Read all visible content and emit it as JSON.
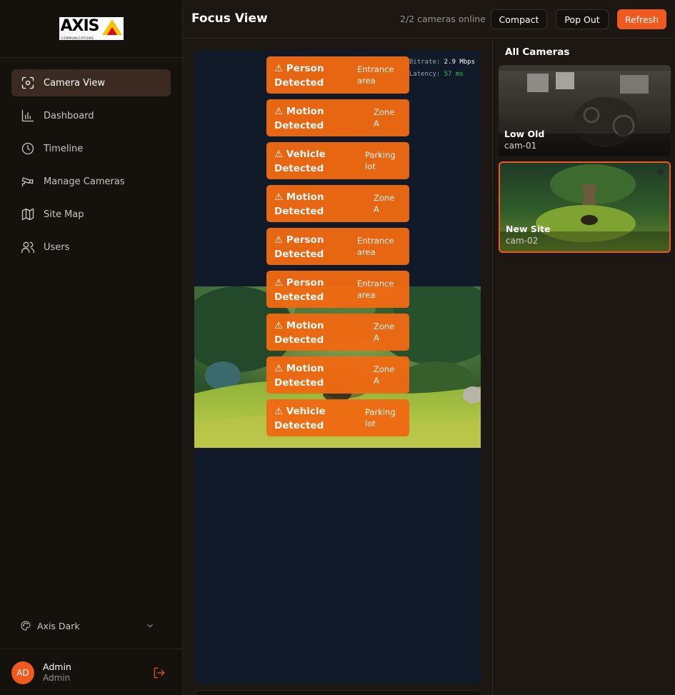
{
  "brand": {
    "logo_text": "AXIS",
    "logo_sub": "COMMUNICATIONS"
  },
  "sidebar": {
    "items": [
      {
        "label": "Camera View",
        "icon": "camera-focus-icon",
        "active": true
      },
      {
        "label": "Dashboard",
        "icon": "bar-chart-icon",
        "active": false
      },
      {
        "label": "Timeline",
        "icon": "clock-icon",
        "active": false
      },
      {
        "label": "Manage Cameras",
        "icon": "cctv-icon",
        "active": false
      },
      {
        "label": "Site Map",
        "icon": "map-icon",
        "active": false
      },
      {
        "label": "Users",
        "icon": "users-icon",
        "active": false
      }
    ],
    "theme": {
      "label": "Axis Dark",
      "icon": "palette-icon"
    },
    "user": {
      "initials": "AD",
      "name": "Admin",
      "role": "Admin"
    }
  },
  "header": {
    "title": "Focus View",
    "status": "2/2 cameras online",
    "buttons": {
      "compact": "Compact",
      "popout": "Pop Out",
      "refresh": "Refresh"
    }
  },
  "focus": {
    "stats": {
      "bitrate_label": "Bitrate:",
      "bitrate_value": "2.9 Mbps",
      "latency_label": "Latency:",
      "latency_value": "57 ms"
    },
    "alerts": [
      {
        "title": "⚠ Person Detected",
        "zone": "Entrance area"
      },
      {
        "title": "⚠ Motion Detected",
        "zone": "Zone A"
      },
      {
        "title": "⚠ Vehicle Detected",
        "zone": "Parking lot"
      },
      {
        "title": "⚠ Motion Detected",
        "zone": "Zone A"
      },
      {
        "title": "⚠ Person Detected",
        "zone": "Entrance area"
      },
      {
        "title": "⚠ Person Detected",
        "zone": "Entrance area"
      },
      {
        "title": "⚠ Motion Detected",
        "zone": "Zone A"
      },
      {
        "title": "⚠ Motion Detected",
        "zone": "Zone A"
      },
      {
        "title": "⚠ Vehicle Detected",
        "zone": "Parking lot"
      }
    ]
  },
  "cameras": {
    "title": "All Cameras",
    "list": [
      {
        "name": "Low Old",
        "id": "cam-01",
        "selected": false
      },
      {
        "name": "New Site",
        "id": "cam-02",
        "selected": true
      }
    ]
  },
  "colors": {
    "accent": "#f05a1e",
    "alert": "#f06a12",
    "panel": "#111a28",
    "online": "#22c55e"
  }
}
